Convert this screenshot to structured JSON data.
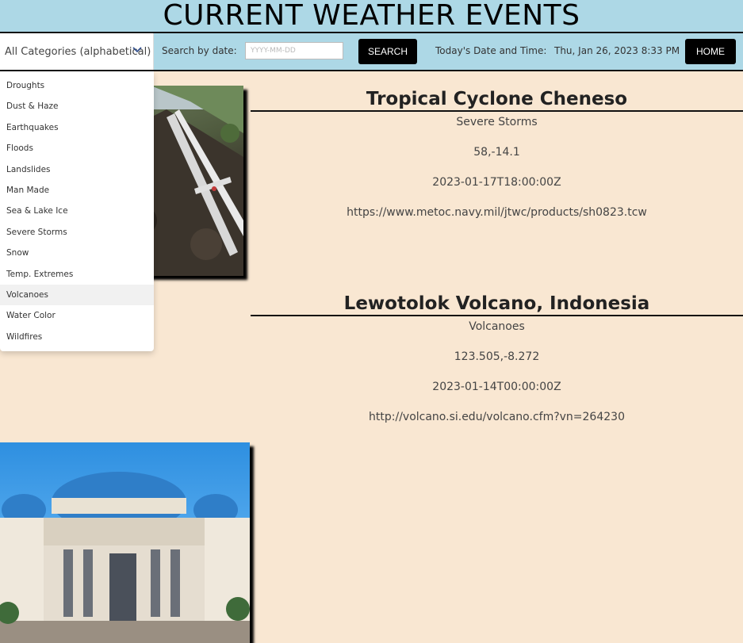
{
  "header": {
    "title": "CURRENT WEATHER EVENTS"
  },
  "toolbar": {
    "category_select": "All Categories (alphabetical)",
    "search_label": "Search by date:",
    "date_placeholder": "YYYY-MM-DD",
    "search_button": "SEARCH",
    "now_label": "Today's Date and Time:",
    "now_value": "Thu, Jan 26, 2023 8:33 PM",
    "home_button": "HOME"
  },
  "categories": [
    "Droughts",
    "Dust & Haze",
    "Earthquakes",
    "Floods",
    "Landslides",
    "Man Made",
    "Sea & Lake Ice",
    "Severe Storms",
    "Snow",
    "Temp. Extremes",
    "Volcanoes",
    "Water Color",
    "Wildfires"
  ],
  "highlighted_category": "Volcanoes",
  "events": [
    {
      "title": "Tropical Cyclone Cheneso",
      "category": "Severe Storms",
      "coords": "58,-14.1",
      "date": "2023-01-17T18:00:00Z",
      "url": "https://www.metoc.navy.mil/jtwc/products/sh0823.tcw"
    },
    {
      "title": "Lewotolok Volcano, Indonesia",
      "category": "Volcanoes",
      "coords": "123.505,-8.272",
      "date": "2023-01-14T00:00:00Z",
      "url": "http://volcano.si.edu/volcano.cfm?vn=264230"
    }
  ],
  "colors": {
    "header_bg": "#add8e6",
    "page_bg": "#f9e7d2",
    "button_bg": "#000000"
  }
}
